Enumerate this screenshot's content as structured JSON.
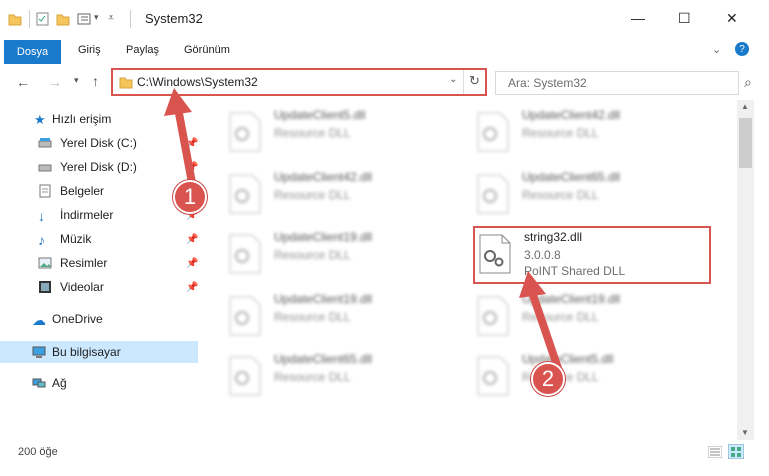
{
  "window": {
    "title": "System32"
  },
  "ribbon": {
    "tabs": [
      "Dosya",
      "Giriş",
      "Paylaş",
      "Görünüm"
    ]
  },
  "address": {
    "path": "C:\\Windows\\System32",
    "search_placeholder": "Ara: System32"
  },
  "nav": {
    "items": [
      {
        "label": "Hızlı erişim"
      },
      {
        "label": "Yerel Disk (C:)"
      },
      {
        "label": "Yerel Disk (D:)"
      },
      {
        "label": "Belgeler"
      },
      {
        "label": "İndirmeler"
      },
      {
        "label": "Müzik"
      },
      {
        "label": "Resimler"
      },
      {
        "label": "Videolar"
      },
      {
        "label": "OneDrive"
      },
      {
        "label": "Bu bilgisayar"
      },
      {
        "label": "Ağ"
      }
    ]
  },
  "files": [
    {
      "name": "UpdateClient5.dll",
      "type": "Resource DLL"
    },
    {
      "name": "UpdateClient42.dll",
      "type": "Resource DLL"
    },
    {
      "name": "UpdateClient42.dll",
      "type": "Resource DLL"
    },
    {
      "name": "UpdateClient65.dll",
      "type": "Resource DLL"
    },
    {
      "name": "UpdateClient19.dll",
      "type": "Resource DLL"
    },
    {
      "name": "string32.dll",
      "version": "3.0.0.8",
      "description": "PoINT Shared DLL"
    },
    {
      "name": "UpdateClient19.dll",
      "type": "Resource DLL"
    },
    {
      "name": "UpdateClient19.dll",
      "type": "Resource DLL"
    },
    {
      "name": "UpdateClient65.dll",
      "type": "Resource DLL"
    },
    {
      "name": "UpdateClient5.dll",
      "type": "Resource DLL"
    }
  ],
  "status": {
    "count": "200 öğe"
  },
  "callouts": [
    "1",
    "2"
  ],
  "colors": {
    "accent": "#1979ca",
    "highlight": "#d9534f"
  }
}
